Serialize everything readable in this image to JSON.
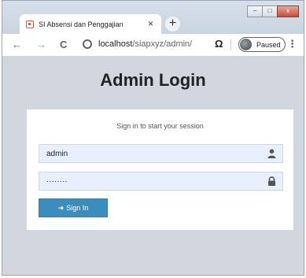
{
  "browser": {
    "tab_title": "SI Absensi dan Penggajian",
    "tab_close": "×",
    "new_tab": "+",
    "win_min": "–",
    "win_max": "□",
    "win_close": "x",
    "back": "←",
    "forward": "→",
    "reload": "C",
    "url_host": "localhost",
    "url_path": "/siapxyz/admin/",
    "extension_symbol": "Ω",
    "profile_label": "Paused",
    "menu": "⋮"
  },
  "login": {
    "title": "Admin Login",
    "subtitle": "Sign in to start your session",
    "username_value": "admin",
    "password_value": "········",
    "signin_icon": "➔",
    "signin_label": "Sign In"
  },
  "icons": {
    "username": "user-icon",
    "password": "lock-icon",
    "signin": "sign-in-icon"
  }
}
